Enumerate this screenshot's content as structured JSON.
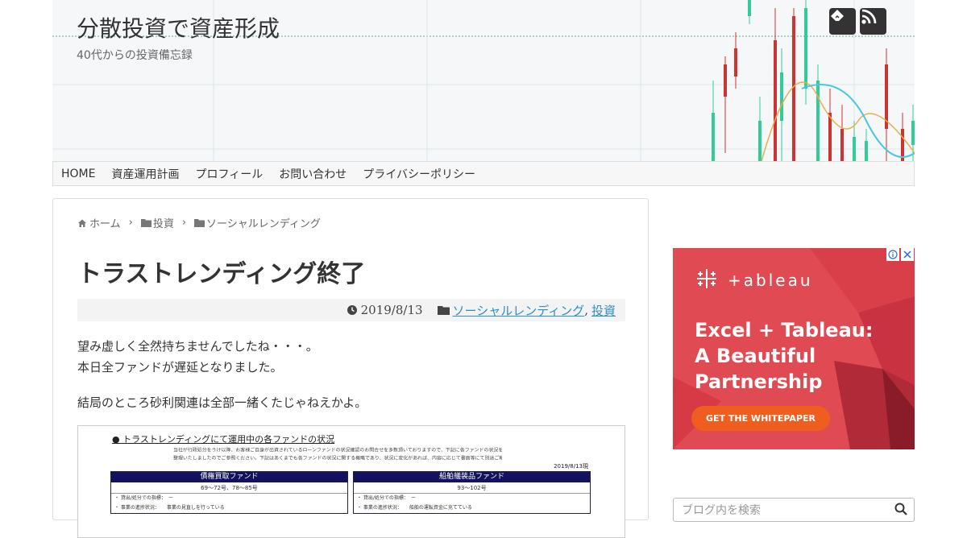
{
  "header": {
    "site_title": "分散投資で資産形成",
    "site_description": "40代からの投資備忘録",
    "sns": [
      {
        "icon": "feedly-icon"
      },
      {
        "icon": "rss-icon"
      }
    ]
  },
  "nav": {
    "items": [
      "HOME",
      "資産運用計画",
      "プロフィール",
      "お問い合わせ",
      "プライバシーポリシー"
    ]
  },
  "breadcrumb": {
    "home": "ホーム",
    "cat1": "投資",
    "cat2": "ソーシャルレンディング"
  },
  "post": {
    "title": "トラストレンディング終了",
    "date": "2019/8/13",
    "categories": [
      "ソーシャルレンディング",
      "投資"
    ],
    "category_sep": ",",
    "paragraphs": [
      "望み虚しく全然持ちませんでしたね・・・。",
      "本日全ファンドが遅延となりました。",
      "結局のところ砂利関連は全部一緒くたじゃねえかよ。"
    ]
  },
  "document": {
    "heading": "● トラストレンディングにて運用中の各ファンドの状況",
    "line1": "当社が行政処分をうけ以降、お客様ご自身が出資されているローンファンドの状況確認のお問合せを多数頂いておりますので、下記に各ファンドの状況を簡単に",
    "line2": "整理いたしましたのでご参照ください。下記はあくまでも各ファンドの状況に関する概略であり、状況に変化があれば、内容に応じて書面等にて別途ご報告致します。",
    "date": "2019/8/13現",
    "boxes": [
      {
        "title": "債権買取ファンド",
        "range": "69〜72号、78〜85号",
        "row1": "・ 貸出/処分での指標：　ー",
        "row2": "・ 事業の進捗状況：　　事業の見直しを行っている"
      },
      {
        "title": "船舶艤装品ファンド",
        "range": "93〜102号",
        "row1": "・ 貸出/処分での指標：　ー",
        "row2": "・ 事業の進捗状況：　　船舶の運転資金に充てている"
      }
    ]
  },
  "ad": {
    "brand": "+ableau",
    "headline1": "Excel + Tableau:",
    "headline2": "A Beautiful",
    "headline3": "Partnership",
    "cta": "GET THE WHITEPAPER",
    "info_icon": "info-icon",
    "close_icon": "close-icon"
  },
  "search": {
    "placeholder": "ブログ内を検索"
  },
  "colors": {
    "link": "#2b8fc3",
    "ad_bg": "#e04a52",
    "ad_cta": "#f05e1f",
    "doc_header": "#12125e"
  }
}
